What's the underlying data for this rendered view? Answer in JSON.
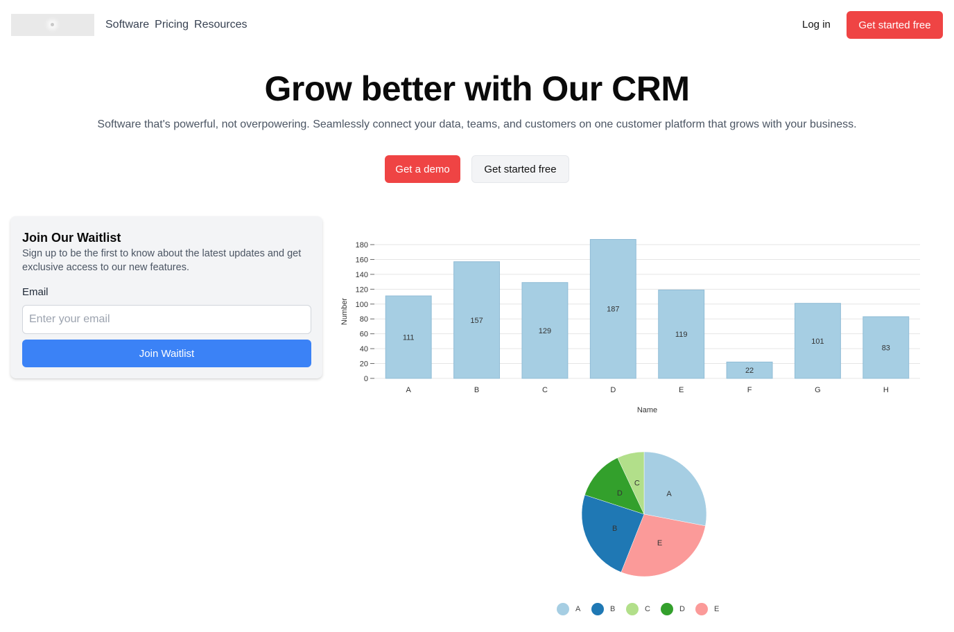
{
  "nav": {
    "links": [
      "Software",
      "Pricing",
      "Resources"
    ],
    "login": "Log in",
    "cta": "Get started free"
  },
  "hero": {
    "title": "Grow better with Our CRM",
    "subtitle": "Software that's powerful, not overpowering. Seamlessly connect your data, teams, and customers on one customer platform that grows with your business.",
    "demo_button": "Get a demo",
    "free_button": "Get started free"
  },
  "waitlist": {
    "title": "Join Our Waitlist",
    "description": "Sign up to be the first to know about the latest updates and get exclusive access to our new features.",
    "email_label": "Email",
    "email_placeholder": "Enter your email",
    "email_value": "",
    "button": "Join Waitlist"
  },
  "colors": {
    "brand_red": "#ef4444",
    "button_blue": "#3b82f6",
    "bar_fill": "#a6cee3"
  },
  "chart_data": [
    {
      "type": "bar",
      "categories": [
        "A",
        "B",
        "C",
        "D",
        "E",
        "F",
        "G",
        "H"
      ],
      "values": [
        111,
        157,
        129,
        187,
        119,
        22,
        101,
        83
      ],
      "xlabel": "Name",
      "ylabel": "Number",
      "ylim": [
        0,
        180
      ],
      "yticks": [
        0,
        20,
        40,
        60,
        80,
        100,
        120,
        140,
        160,
        180
      ],
      "grid": true,
      "data_labels": true,
      "color": "#a6cee3"
    },
    {
      "type": "pie",
      "categories": [
        "A",
        "B",
        "C",
        "D",
        "E"
      ],
      "values": [
        28,
        24,
        7,
        13,
        28
      ],
      "colors": [
        "#a6cee3",
        "#1f78b4",
        "#b2df8a",
        "#33a02c",
        "#fb9a99"
      ],
      "legend": "bottom"
    }
  ]
}
